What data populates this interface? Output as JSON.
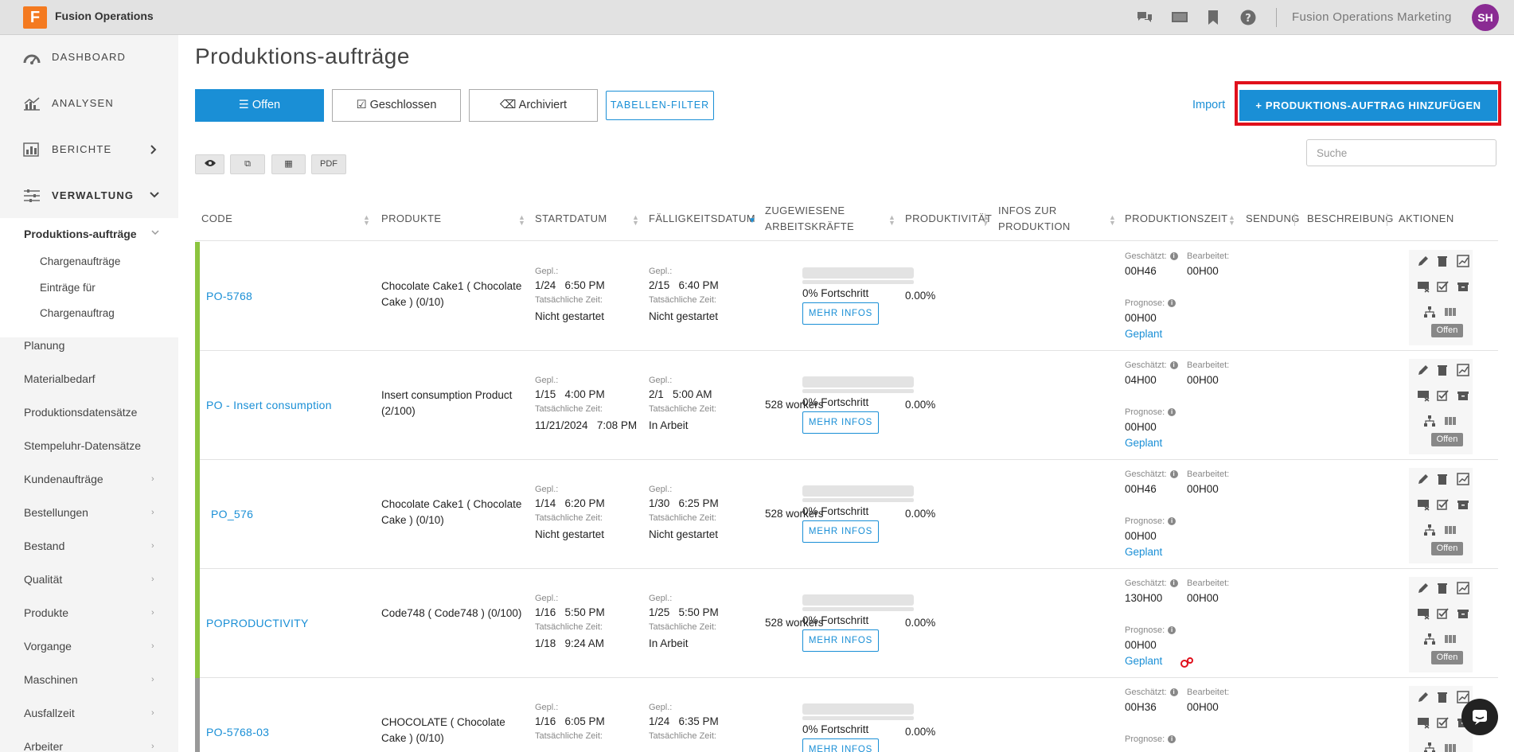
{
  "app": {
    "logo_letter": "F",
    "name": "Fusion Operations",
    "org": "Fusion Operations Marketing",
    "avatar": "SH"
  },
  "sidebar": {
    "main": [
      {
        "label": "DASHBOARD",
        "icon": "dashboard-icon"
      },
      {
        "label": "ANALYSEN",
        "icon": "analytics-icon"
      },
      {
        "label": "BERICHTE",
        "icon": "reports-icon"
      },
      {
        "label": "VERWALTUNG",
        "icon": "settings-sliders-icon"
      }
    ],
    "active": "Produktions-aufträge",
    "subitems": [
      "Chargenaufträge",
      "Einträge für",
      "Chargenauftrag"
    ],
    "items": [
      "Planung",
      "Materialbedarf",
      "Produktionsdatensätze",
      "Stempeluhr-Datensätze",
      "Kundenaufträge",
      "Bestellungen",
      "Bestand",
      "Qualität",
      "Produkte",
      "Vorgange",
      "Maschinen",
      "Ausfallzeit",
      "Arbeiter"
    ]
  },
  "page": {
    "title": "Produktions-aufträge",
    "tabs": [
      "Offen",
      "Geschlossen",
      "Archiviert"
    ],
    "filter_button": "TABELLEN-FILTER",
    "import_link": "Import",
    "add_button": "PRODUKTIONS-AUFTRAG HINZUFÜGEN",
    "search_placeholder": "Suche",
    "pdf_button": "PDF"
  },
  "table": {
    "columns": [
      "CODE",
      "PRODUKTE",
      "STARTDATUM",
      "FÄLLIGKEITSDATUM",
      "ZUGEWIESENE ARBEITSKRÄFTE",
      "PRODUKTIVITÄT",
      "INFOS ZUR PRODUKTION",
      "PRODUKTIONSZEIT",
      "SENDUNG",
      "BESCHREIBUNG",
      "AKTIONEN"
    ],
    "labels": {
      "planned": "Gepl.:",
      "actual": "Tatsächliche Zeit:",
      "estimated": "Geschätzt:",
      "processed": "Bearbeitet:",
      "forecast": "Prognose:",
      "more": "MEHR INFOS"
    },
    "rows": [
      {
        "code": "PO-5768",
        "product": "Chocolate Cake1 ( Chocolate Cake ) (0/10)",
        "start_planned": "1/24   6:50 PM",
        "start_actual": "Nicht gestartet",
        "due_planned": "2/15   6:40 PM",
        "due_actual": "Nicht gestartet",
        "workers": "",
        "productivity": "0.00%",
        "progress": 0,
        "progress_text": "0% Fortschritt",
        "estimated": "00H46",
        "processed": "00H00",
        "forecast": "00H00",
        "planned_status": "Geplant",
        "status": "Offen",
        "bar_color": "#8cc43f",
        "gear": false
      },
      {
        "code": "PO - Insert consumption",
        "product": "Insert consumption Product (2/100)",
        "start_planned": "1/15   4:00 PM",
        "start_actual": "11/21/2024   7:08 PM",
        "due_planned": "2/1   5:00 AM",
        "due_actual": "In Arbeit",
        "workers": "528 workers",
        "productivity": "0.00%",
        "progress": 0,
        "progress_text": "0% Fortschritt",
        "estimated": "04H00",
        "processed": "00H00",
        "forecast": "00H00",
        "planned_status": "Geplant",
        "status": "Offen",
        "bar_color": "#8cc43f",
        "gear": false
      },
      {
        "code": "PO_576",
        "product": "Chocolate Cake1 ( Chocolate Cake ) (0/10)",
        "start_planned": "1/14   6:20 PM",
        "start_actual": "Nicht gestartet",
        "due_planned": "1/30   6:25 PM",
        "due_actual": "Nicht gestartet",
        "workers": "528 workers",
        "productivity": "0.00%",
        "progress": 0,
        "progress_text": "0% Fortschritt",
        "estimated": "00H46",
        "processed": "00H00",
        "forecast": "00H00",
        "planned_status": "Geplant",
        "status": "Offen",
        "bar_color": "#8cc43f",
        "gear": false
      },
      {
        "code": "POPRODUCTIVITY",
        "product": "Code748 ( Code748 ) (0/100)",
        "start_planned": "1/16   5:50 PM",
        "start_actual": "1/18   9:24 AM",
        "due_planned": "1/25   5:50 PM",
        "due_actual": "In Arbeit",
        "workers": "528 workers",
        "productivity": "0.00%",
        "progress": 0,
        "progress_text": "0% Fortschritt",
        "estimated": "130H00",
        "processed": "00H00",
        "forecast": "00H00",
        "planned_status": "Geplant",
        "status": "Offen",
        "bar_color": "#8cc43f",
        "gear": true
      },
      {
        "code": "PO-5768-03",
        "product": "CHOCOLATE ( Chocolate Cake ) (0/10)",
        "start_planned": "1/16   6:05 PM",
        "start_actual": "",
        "due_planned": "1/24   6:35 PM",
        "due_actual": "",
        "workers": "",
        "productivity": "0.00%",
        "progress": 0,
        "progress_text": "0% Fortschritt",
        "estimated": "00H36",
        "processed": "00H00",
        "forecast": "",
        "planned_status": "",
        "status": "",
        "bar_color": "#999999",
        "gear": false
      }
    ]
  },
  "colors": {
    "accent": "#1a8fd6",
    "highlight": "#e0101c",
    "open_bar": "#8cc43f",
    "closed_bar": "#999999"
  }
}
